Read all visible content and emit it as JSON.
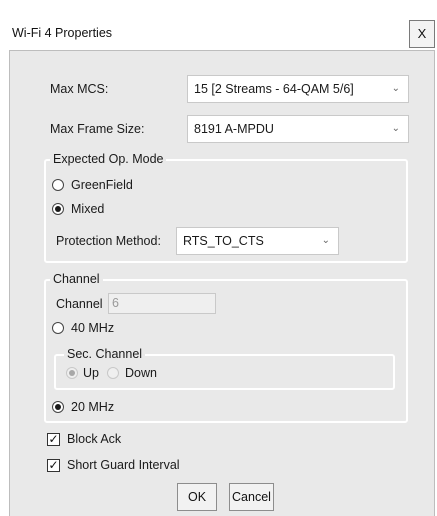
{
  "window": {
    "title": "Wi-Fi 4 Properties",
    "close_label": "X"
  },
  "max_mcs": {
    "label": "Max MCS:",
    "value": "15 [2 Streams - 64-QAM 5/6]"
  },
  "max_frame_size": {
    "label": "Max Frame Size:",
    "value": "8191 A-MPDU"
  },
  "op_mode": {
    "legend": "Expected Op. Mode",
    "greenfield": "GreenField",
    "mixed": "Mixed",
    "selected": "Mixed",
    "protection_label": "Protection Method:",
    "protection_value": "RTS_TO_CTS"
  },
  "channel": {
    "legend": "Channel",
    "channel_label": "Channel",
    "channel_value": "6",
    "mhz40": "40 MHz",
    "mhz20": "20 MHz",
    "selected_width": "20 MHz",
    "sec_channel": {
      "legend": "Sec. Channel",
      "up": "Up",
      "down": "Down",
      "selected": "Up"
    }
  },
  "options": {
    "block_ack": "Block Ack",
    "block_ack_checked": true,
    "short_guard": "Short Guard Interval",
    "short_guard_checked": true
  },
  "buttons": {
    "ok": "OK",
    "cancel": "Cancel"
  },
  "icons": {
    "dropdown": "chevron-down-icon",
    "check": "checkmark-icon"
  }
}
